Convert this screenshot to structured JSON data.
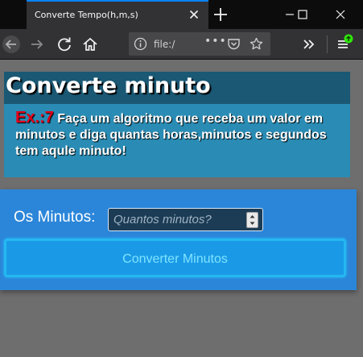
{
  "window": {
    "tab_title": "Converte Tempo(h,m,s)"
  },
  "toolbar": {
    "url": "file:/",
    "url_dots": "•••"
  },
  "page": {
    "title": "Converte minuto",
    "exercise_label": "Ex.:7",
    "description": " Faça um algoritmo que receba um valor em minutos e diga quantas horas,minutos e segundos tem aqule minuto!",
    "minutes_label": "Os Minutos:",
    "minutes_placeholder": "Quantos minutos?",
    "convert_button": "Converter Minutos"
  },
  "colors": {
    "tab_accent": "#0a84ff",
    "header_dark": "#1a5874",
    "header_light": "#2a8cb4",
    "exercise_red": "#e3001a",
    "form_blue": "#2b86d9",
    "button_blue": "#1a9ae6"
  },
  "icons": [
    "close-icon",
    "plus-icon",
    "minimize-icon",
    "maximize-icon",
    "back-icon",
    "forward-icon",
    "reload-icon",
    "home-icon",
    "info-icon",
    "pocket-icon",
    "star-icon",
    "chevron-double-right-icon",
    "hamburger-menu-icon",
    "update-available-icon",
    "spinner-up-icon",
    "spinner-down-icon"
  ]
}
